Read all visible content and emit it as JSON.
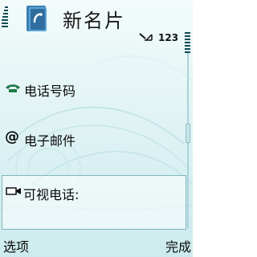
{
  "header": {
    "title": "新名片",
    "mode_indicator": "123",
    "icons": [
      "signal-icon",
      "contact-card-icon",
      "pen-icon",
      "battery-icon"
    ]
  },
  "fields": [
    {
      "label": "电话号码",
      "icon": "phone-icon"
    },
    {
      "label": "电子邮件",
      "icon": "at-icon",
      "icon_text": "@"
    },
    {
      "label": "可视电话:",
      "icon": "video-call-icon"
    }
  ],
  "softkeys": {
    "left": "选项",
    "right": "完成"
  },
  "colors": {
    "background": "#d7eff1",
    "accent": "#0b4a55",
    "highlight_border": "#7fb7be"
  }
}
